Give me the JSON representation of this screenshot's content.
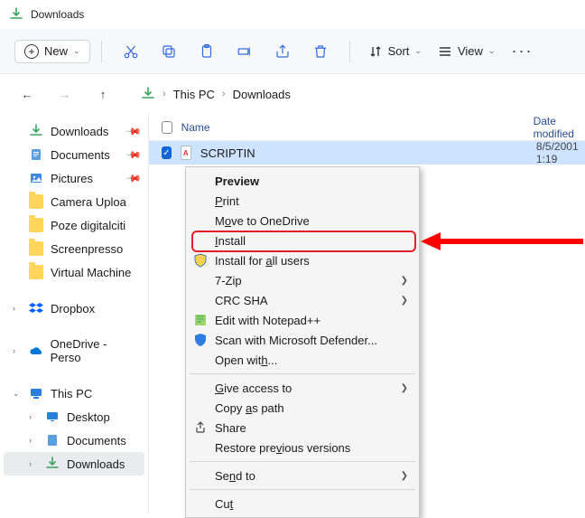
{
  "window": {
    "title": "Downloads"
  },
  "cmdbar": {
    "new": "New",
    "sort": "Sort",
    "view": "View"
  },
  "breadcrumb": {
    "seg1": "This PC",
    "seg2": "Downloads"
  },
  "sidebar": {
    "downloads": "Downloads",
    "documents": "Documents",
    "pictures": "Pictures",
    "camera": "Camera Uploa",
    "poze": "Poze digitalciti",
    "screenpresso": "Screenpresso",
    "vm": "Virtual Machine",
    "dropbox": "Dropbox",
    "onedrive": "OneDrive - Perso",
    "thispc": "This PC",
    "desktop": "Desktop",
    "documents2": "Documents",
    "downloads2": "Downloads"
  },
  "columns": {
    "name": "Name",
    "date": "Date modified"
  },
  "file": {
    "name": "SCRIPTIN",
    "date": "8/5/2001 1:19"
  },
  "menu": {
    "preview": "Preview",
    "print": "Print",
    "onedrive": "Move to OneDrive",
    "install": "Install",
    "install_all": "Install for all users",
    "sevenzip": "7-Zip",
    "crcsha": "CRC SHA",
    "notepad": "Edit with Notepad++",
    "defender": "Scan with Microsoft Defender...",
    "openwith": "Open with...",
    "giveaccess": "Give access to",
    "copypath": "Copy as path",
    "share": "Share",
    "restore": "Restore previous versions",
    "sendto": "Send to",
    "cut": "Cut"
  }
}
